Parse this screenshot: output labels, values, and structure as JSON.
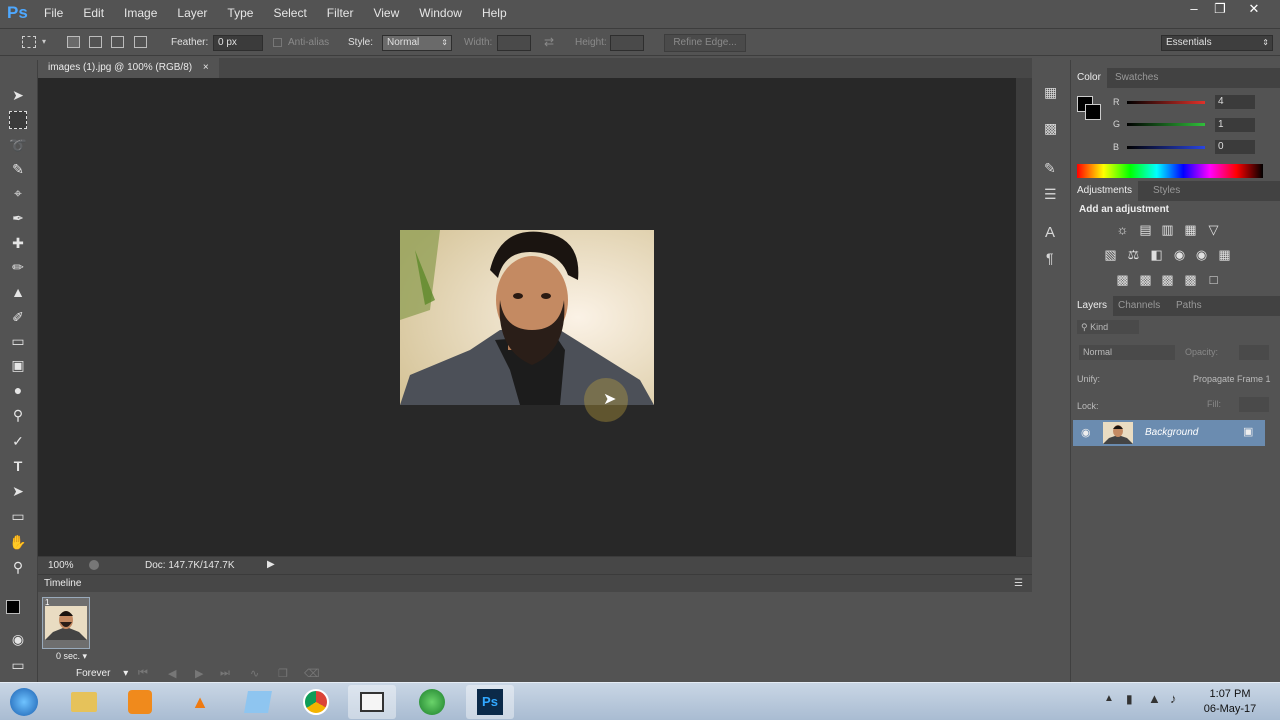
{
  "app": {
    "logo": "Ps"
  },
  "menu": [
    "File",
    "Edit",
    "Image",
    "Layer",
    "Type",
    "Select",
    "Filter",
    "View",
    "Window",
    "Help"
  ],
  "options": {
    "feather_label": "Feather:",
    "feather_value": "0 px",
    "antialias_label": "Anti-alias",
    "style_label": "Style:",
    "style_value": "Normal",
    "width_label": "Width:",
    "height_label": "Height:",
    "refine_edge": "Refine Edge...",
    "workspace": "Essentials"
  },
  "document": {
    "tab_title": "images (1).jpg @ 100% (RGB/8)",
    "tab_close": "×",
    "zoom": "100%",
    "doc_info": "Doc: 147.7K/147.7K"
  },
  "timeline": {
    "title": "Timeline",
    "frame_number": "1",
    "frame_delay": "0 sec.",
    "loop": "Forever"
  },
  "color_panel": {
    "tabs": [
      "Color",
      "Swatches"
    ],
    "channels": [
      {
        "label": "R",
        "value": "4",
        "color": "#e0312a"
      },
      {
        "label": "G",
        "value": "1",
        "color": "#2fbf3a"
      },
      {
        "label": "B",
        "value": "0",
        "color": "#2a45e0"
      }
    ]
  },
  "adjustments_panel": {
    "tabs": [
      "Adjustments",
      "Styles"
    ],
    "heading": "Add an adjustment"
  },
  "layers_panel": {
    "tabs": [
      "Layers",
      "Channels",
      "Paths"
    ],
    "kind": "Kind",
    "blend_mode": "Normal",
    "opacity_label": "Opacity:",
    "unify_label": "Unify:",
    "propagate_label": "Propagate Frame 1",
    "lock_label": "Lock:",
    "fill_label": "Fill:",
    "layer_name": "Background"
  },
  "taskbar": {
    "time": "1:07 PM",
    "date": "06-May-17"
  },
  "colors": {
    "accent": "#4ea8ff",
    "selected_layer": "#6b8cb0"
  }
}
